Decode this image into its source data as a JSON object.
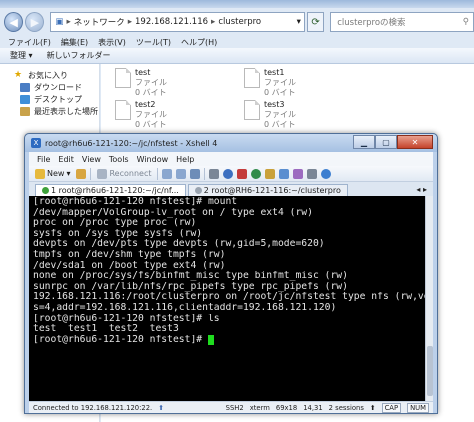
{
  "explorer": {
    "breadcrumb": [
      "ネットワーク",
      "192.168.121.116",
      "clusterpro"
    ],
    "search_placeholder": "clusterproの検索",
    "menu": [
      "ファイル(F)",
      "編集(E)",
      "表示(V)",
      "ツール(T)",
      "ヘルプ(H)"
    ],
    "commands": {
      "organize": "整理 ▾",
      "new_folder": "新しいフォルダー"
    },
    "nav_items": [
      "お気に入り",
      "ダウンロード",
      "デスクトップ",
      "最近表示した場所"
    ],
    "files": [
      {
        "name": "test",
        "type": "ファイル",
        "size": "0 バイト"
      },
      {
        "name": "test1",
        "type": "ファイル",
        "size": "0 バイト"
      },
      {
        "name": "test2",
        "type": "ファイル",
        "size": "0 バイト"
      },
      {
        "name": "test3",
        "type": "ファイル",
        "size": "0 バイト"
      }
    ]
  },
  "xshell": {
    "title": "root@rh6u6-121-120:~/jc/nfstest - Xshell 4",
    "menu": [
      "File",
      "Edit",
      "View",
      "Tools",
      "Window",
      "Help"
    ],
    "toolbar": {
      "new": "New",
      "reconnect": "Reconnect"
    },
    "tabs": [
      {
        "label": "1 root@rh6u6-121-120:~/jc/nf..."
      },
      {
        "label": "2 root@RH6-121-116:~/clusterpro"
      }
    ],
    "terminal_lines": [
      "[root@rh6u6-121-120 nfstest]# mount",
      "/dev/mapper/VolGroup-lv_root on / type ext4 (rw)",
      "proc on /proc type proc (rw)",
      "sysfs on /sys type sysfs (rw)",
      "devpts on /dev/pts type devpts (rw,gid=5,mode=620)",
      "tmpfs on /dev/shm type tmpfs (rw)",
      "/dev/sda1 on /boot type ext4 (rw)",
      "none on /proc/sys/fs/binfmt_misc type binfmt_misc (rw)",
      "sunrpc on /var/lib/nfs/rpc_pipefs type rpc_pipefs (rw)",
      "192.168.121.116:/root/clusterpro on /root/jc/nfstest type nfs (rw,ver",
      "s=4,addr=192.168.121.116,clientaddr=192.168.121.120)",
      "[root@rh6u6-121-120 nfstest]# ls",
      "test  test1  test2  test3"
    ],
    "prompt": "[root@rh6u6-121-120 nfstest]# ",
    "status": {
      "connection": "Connected to 192.168.121.120:22.",
      "protocol": "SSH2",
      "term": "xterm",
      "size": "69x18",
      "cursor": "14,31",
      "sessions": "2 sessions",
      "cap": "CAP",
      "num": "NUM"
    },
    "colors": {
      "cursor": "#1fdc1f",
      "terminal_bg": "#000000",
      "terminal_fg": "#e4e4e4"
    }
  }
}
